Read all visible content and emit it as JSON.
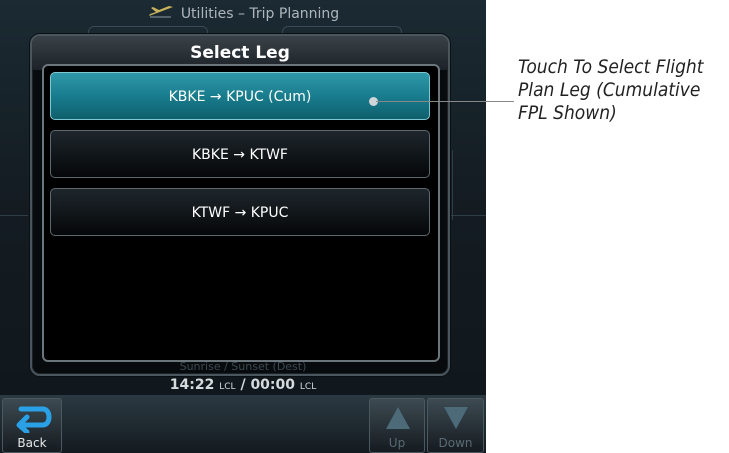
{
  "titlebar": {
    "icon": "airplane-icon",
    "title": "Utilities – Trip Planning"
  },
  "dialog": {
    "title": "Select Leg",
    "legs": [
      {
        "label": "KBKE → KPUC (Cum)",
        "selected": true
      },
      {
        "label": "KBKE → KTWF",
        "selected": false
      },
      {
        "label": "KTWF → KPUC",
        "selected": false
      }
    ]
  },
  "status": {
    "label": "Sunrise / Sunset (Dest)",
    "sunrise": "14:22",
    "sunset": "00:00",
    "unit": "LCL",
    "separator": "/"
  },
  "softkeys": {
    "back": {
      "label": "Back",
      "icon": "back-arrow-icon"
    },
    "up": {
      "label": "Up",
      "icon": "up-arrow-icon"
    },
    "down": {
      "label": "Down",
      "icon": "down-arrow-icon"
    }
  },
  "callout": {
    "text": "Touch To Select Flight Plan Leg (Cumulative FPL Shown)"
  },
  "colors": {
    "selected": "#1f8797",
    "panel": "#080b0d",
    "border": "#6b757c"
  }
}
